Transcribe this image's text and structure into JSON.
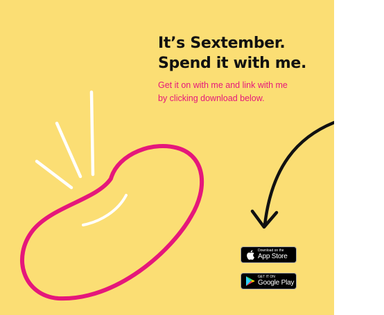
{
  "headline": {
    "line1": "It’s Sextember.",
    "line2": "Spend it with me."
  },
  "subtext": {
    "line1": "Get it on with me and  link with me",
    "line2": "by clicking download below."
  },
  "badges": {
    "app_store": {
      "small": "Download on the",
      "big": "App Store",
      "icon": "apple-icon"
    },
    "google_play": {
      "small": "GET IT ON",
      "big": "Google Play",
      "icon": "google-play-icon"
    }
  },
  "colors": {
    "background": "#fbde74",
    "headline": "#111111",
    "accent": "#e5177b",
    "highlight": "#ffffff",
    "arrow": "#111111",
    "badge": "#000000"
  }
}
